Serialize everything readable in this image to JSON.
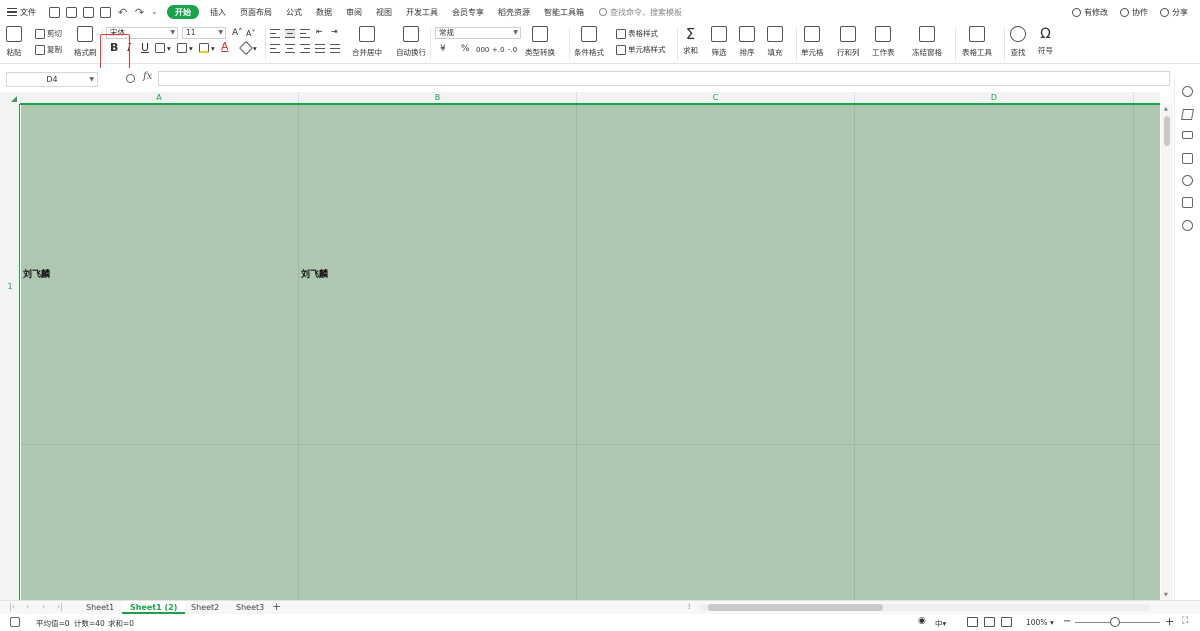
{
  "menubar": {
    "file": "文件",
    "tabs": [
      "开始",
      "插入",
      "页面布局",
      "公式",
      "数据",
      "审阅",
      "视图",
      "开发工具",
      "会员专享",
      "稻壳资源",
      "智能工具箱"
    ],
    "search_placeholder": "查找命令、搜索模板",
    "right": {
      "changes": "有修改",
      "collab": "协作",
      "share": "分享"
    }
  },
  "ribbon": {
    "paste": "粘贴",
    "cut": "剪切",
    "copy": "复制",
    "format_painter": "格式刷",
    "font_name": "宋体",
    "font_size": "11",
    "bold": "B",
    "italic": "I",
    "underline": "U",
    "merge_center": "合并居中",
    "wrap_text": "自动换行",
    "number_format": "常规",
    "currency": "¥",
    "percent": "%",
    "thousands": "000",
    "dec_inc": "+.0",
    "dec_dec": "-.0",
    "type_convert": "类型转换",
    "cond_format": "条件格式",
    "table_style": "表格样式",
    "cell_style": "单元格样式",
    "sum": "求和",
    "filter": "筛选",
    "sort": "排序",
    "fill": "填充",
    "cell": "单元格",
    "row_col": "行和列",
    "worksheet": "工作表",
    "freeze": "冻结窗格",
    "table_tools": "表格工具",
    "find": "查找",
    "symbol": "符号"
  },
  "formula_bar": {
    "name_box": "D4",
    "fx": "fx",
    "content": ""
  },
  "grid": {
    "columns": [
      "A",
      "B",
      "C",
      "D"
    ],
    "rows": [
      "1"
    ],
    "cells": {
      "A1": "刘飞麟",
      "B1": "刘飞麟"
    },
    "cell_fill": "#afc7b0",
    "accent": "#1aa34a"
  },
  "sheets": {
    "tabs": [
      "Sheet1",
      "Sheet1 (2)",
      "Sheet2",
      "Sheet3"
    ],
    "active_index": 1
  },
  "status": {
    "avg": "平均值=0",
    "count": "计数=40",
    "sum": "求和=0",
    "zoom": "100%"
  },
  "highlight_color": "#e53935"
}
